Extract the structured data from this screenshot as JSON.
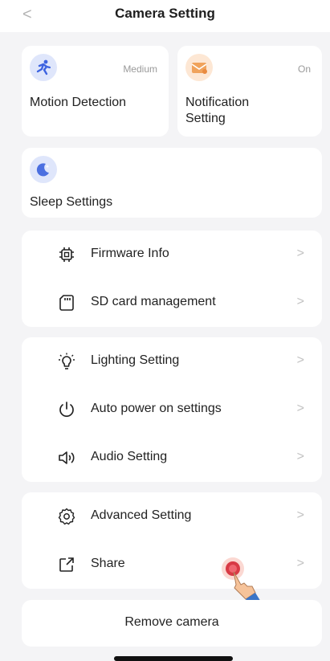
{
  "header": {
    "title": "Camera Setting",
    "back_icon": "chevron-left-icon"
  },
  "tiles": {
    "motion": {
      "label": "Motion Detection",
      "status": "Medium",
      "icon": "running-person-icon",
      "color": "#3d63e0"
    },
    "notification": {
      "label_line1": "Notification",
      "label_line2": "Setting",
      "status": "On",
      "icon": "envelope-icon",
      "color": "#f0a35c"
    },
    "sleep": {
      "label": "Sleep Settings",
      "icon": "moon-icon",
      "color": "#4b6fe0"
    }
  },
  "group1": [
    {
      "label": "Firmware Info",
      "icon": "chip-icon"
    },
    {
      "label": "SD card management",
      "icon": "sd-card-icon"
    }
  ],
  "group2": [
    {
      "label": "Lighting Setting",
      "icon": "bulb-icon"
    },
    {
      "label": "Auto power on settings",
      "icon": "power-icon"
    },
    {
      "label": "Audio Setting",
      "icon": "speaker-icon"
    }
  ],
  "group3": [
    {
      "label": "Advanced Setting",
      "icon": "gear-icon"
    },
    {
      "label": "Share",
      "icon": "share-icon"
    }
  ],
  "remove": {
    "label": "Remove camera"
  },
  "chevron": ">"
}
